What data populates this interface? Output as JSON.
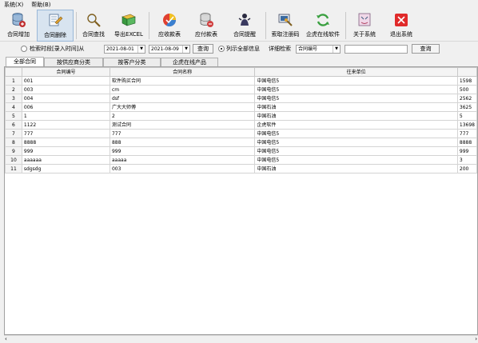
{
  "menu": [
    "系统(X)",
    "帮助(B)"
  ],
  "toolbar": [
    {
      "label": "合同增加",
      "icon": "database-add-icon"
    },
    {
      "label": "合同删除",
      "icon": "delete-document-icon"
    },
    {
      "label": "合同查找",
      "icon": "magnifier-icon"
    },
    {
      "label": "导出EXCEL",
      "icon": "excel-export-icon"
    },
    {
      "label": "应收款表",
      "icon": "receivable-chart-icon"
    },
    {
      "label": "应付款表",
      "icon": "payable-database-icon"
    },
    {
      "label": "合同提醒",
      "icon": "reminder-icon"
    },
    {
      "label": "索取注册码",
      "icon": "register-code-icon"
    },
    {
      "label": "企虎在线软件",
      "icon": "refresh-online-icon"
    },
    {
      "label": "关于系统",
      "icon": "about-icon"
    },
    {
      "label": "退出系统",
      "icon": "exit-icon"
    }
  ],
  "search": {
    "radio_date_label": "检索时段[录入时间]从",
    "date_from": "2021-08-01",
    "date_to": "2021-08-09",
    "query_btn": "查询",
    "radio_all_label": "列示全部信息",
    "detail_label": "详细检索",
    "field_select": "合同编号",
    "keyword": "",
    "query_btn2": "查询"
  },
  "tabs": [
    "全部合同",
    "按供应商分类",
    "按客户分类",
    "企虎在线产品"
  ],
  "table": {
    "headers": [
      "合同编号",
      "合同名称",
      "往来单位",
      ""
    ],
    "rows": [
      [
        "001",
        "软件购买合同",
        "中国电信5",
        "1598"
      ],
      [
        "003",
        "cm",
        "中国电信5",
        "500"
      ],
      [
        "004",
        "dsf",
        "中国电信5",
        "2562"
      ],
      [
        "006",
        "广大大师傅",
        "中国石油",
        "3625"
      ],
      [
        "1",
        "2",
        "中国石油",
        "5"
      ],
      [
        "1122",
        "测试合同",
        "企虎软件",
        "13698"
      ],
      [
        "777",
        "777",
        "中国电信5",
        "777"
      ],
      [
        "8888",
        "888",
        "中国电信5",
        "8888"
      ],
      [
        "999",
        "999",
        "中国电信5",
        "999"
      ],
      [
        "aaaaaa",
        "aaaaa",
        "中国电信5",
        "3"
      ],
      [
        "sdgsdg",
        "003",
        "中国石油",
        "200"
      ]
    ]
  }
}
